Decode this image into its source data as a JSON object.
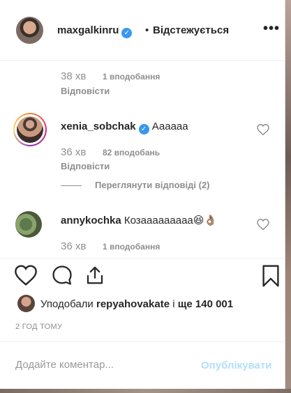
{
  "header": {
    "username": "maxgalkinru",
    "separator": "•",
    "follow_status": "Відстежується",
    "more_label": "•••"
  },
  "comments": [
    {
      "time": "38 хв",
      "likes": "1 вподобання",
      "reply_label": "Відповісти"
    },
    {
      "username": "xenia_sobchak",
      "text": "Аааааа",
      "time": "36 хв",
      "likes": "82 вподобань",
      "reply_label": "Відповісти",
      "view_replies": "Переглянути відповіді (2)"
    },
    {
      "username": "annykochka",
      "text": "Козааааааааа😆👌🏽",
      "time": "36 хв",
      "likes": "1 вподобання"
    }
  ],
  "likes_summary": {
    "prefix": "Уподобали",
    "user": "repyahovakate",
    "middle": "і",
    "count": "ще 140 001"
  },
  "time_ago": "2 ГОД ТОМУ",
  "comment_box": {
    "placeholder": "Додайте коментар...",
    "publish_label": "Опублікувати"
  },
  "colors": {
    "verified": "#3897f0",
    "publish_disabled": "#b2dffc",
    "muted_text": "#8e8e8e"
  }
}
